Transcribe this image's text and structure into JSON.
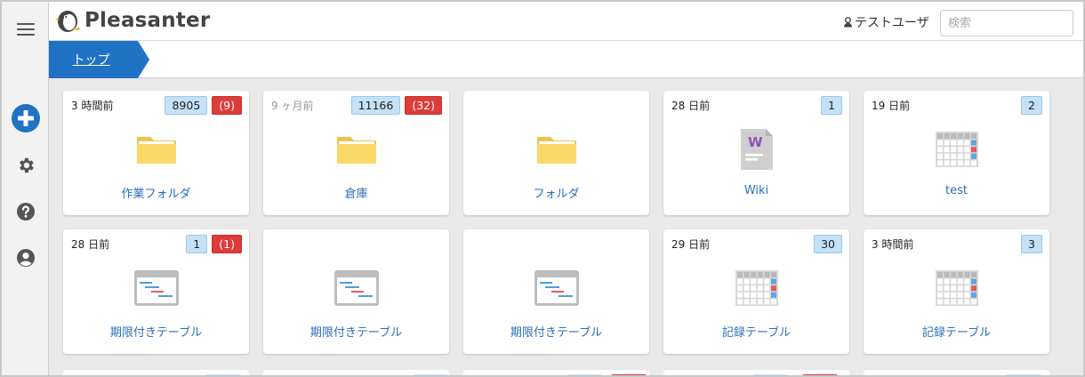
{
  "app": {
    "name": "Pleasanter"
  },
  "header": {
    "user_name": "テストユーザ",
    "search_placeholder": "検索"
  },
  "breadcrumb": {
    "label": "トップ"
  },
  "sidebar": {
    "items": [
      "hamburger-menu-icon",
      "add-icon",
      "gear-icon",
      "help-icon",
      "user-icon"
    ]
  },
  "colors": {
    "accent": "#1f72c4",
    "badge_count": "#c4e1f8",
    "badge_alert": "#de3b3b",
    "link": "#2a6fb8"
  },
  "cards": [
    {
      "time": "3 時間前",
      "count": "8905",
      "alert": "(9)",
      "title": "作業フォルダ",
      "icon": "folder-icon"
    },
    {
      "time": "9 ヶ月前",
      "count": "11166",
      "alert": "(32)",
      "title": "倉庫",
      "icon": "folder-icon"
    },
    {
      "time": "",
      "count": "",
      "alert": "",
      "title": "フォルダ",
      "icon": "folder-icon"
    },
    {
      "time": "28 日前",
      "count": "1",
      "alert": "",
      "title": "Wiki",
      "icon": "wiki-icon"
    },
    {
      "time": "19 日前",
      "count": "2",
      "alert": "",
      "title": "test",
      "icon": "table-icon"
    },
    {
      "time": "28 日前",
      "count": "1",
      "alert": "(1)",
      "title": "期限付きテーブル",
      "icon": "gantt-icon"
    },
    {
      "time": "",
      "count": "",
      "alert": "",
      "title": "期限付きテーブル",
      "icon": "gantt-icon"
    },
    {
      "time": "",
      "count": "",
      "alert": "",
      "title": "期限付きテーブル",
      "icon": "gantt-icon"
    },
    {
      "time": "29 日前",
      "count": "30",
      "alert": "",
      "title": "記録テーブル",
      "icon": "table-icon"
    },
    {
      "time": "3 時間前",
      "count": "3",
      "alert": "",
      "title": "記録テーブル",
      "icon": "table-icon"
    }
  ]
}
